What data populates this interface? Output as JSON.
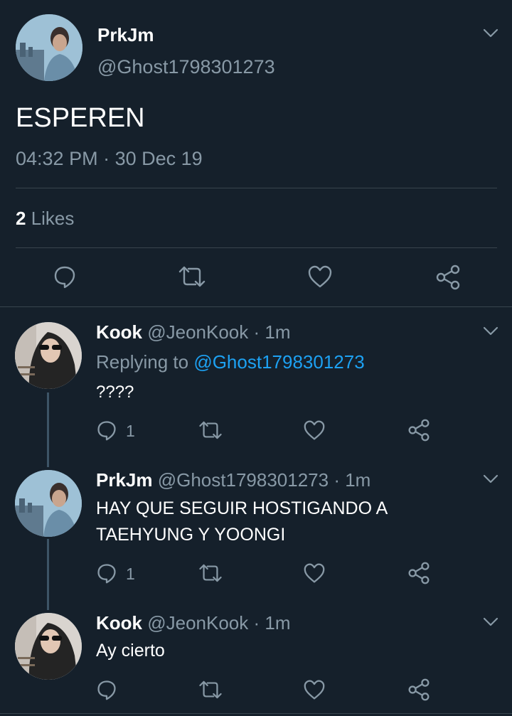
{
  "main_tweet": {
    "name": "PrkJm",
    "handle": "@Ghost1798301273",
    "text": "ESPEREN",
    "time": "04:32 PM",
    "date_sep": " · ",
    "date": "30 Dec 19",
    "likes_count": "2",
    "likes_label": " Likes"
  },
  "replies": [
    {
      "name": "Kook",
      "handle": "@JeonKook",
      "sep": " · ",
      "age": "1m",
      "replying_prefix": "Replying to ",
      "replying_to": "@Ghost1798301273",
      "text": "????",
      "reply_count": "1"
    },
    {
      "name": "PrkJm",
      "handle": "@Ghost1798301273",
      "sep": " · ",
      "age": "1m",
      "text_line1": "HAY QUE SEGUIR HOSTIGANDO A",
      "text_line2": "TAEHYUNG Y YOONGI",
      "reply_count": "1"
    },
    {
      "name": "Kook",
      "handle": "@JeonKook",
      "sep": " · ",
      "age": "1m",
      "text": "Ay cierto"
    }
  ],
  "colors": {
    "background": "#15202b",
    "muted": "#8899a6",
    "link": "#1da1f2",
    "divider": "#38444d"
  }
}
